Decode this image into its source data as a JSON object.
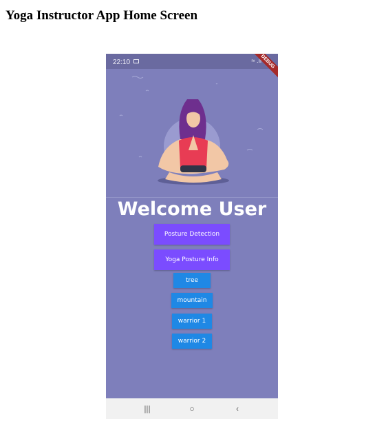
{
  "caption": "Yoga Instructor App Home Screen",
  "status_bar": {
    "time": "22:10",
    "icons": [
      "image-icon",
      "wifi-icon",
      "signal-icon",
      "battery-icon"
    ]
  },
  "debug_banner": "DEBUG",
  "welcome_text": "Welcome User",
  "buttons": {
    "posture_detection": "Posture Detection",
    "posture_info": "Yoga Posture Info",
    "poses": [
      "tree",
      "mountain",
      "warrior 1",
      "warrior 2"
    ]
  },
  "nav_bar": {
    "recents": "|||",
    "home": "○",
    "back": "‹"
  },
  "colors": {
    "background": "#7e7fbb",
    "primary_button": "#7b4cff",
    "pose_button": "#1f88e5",
    "status_bar": "#6a6aa0"
  }
}
